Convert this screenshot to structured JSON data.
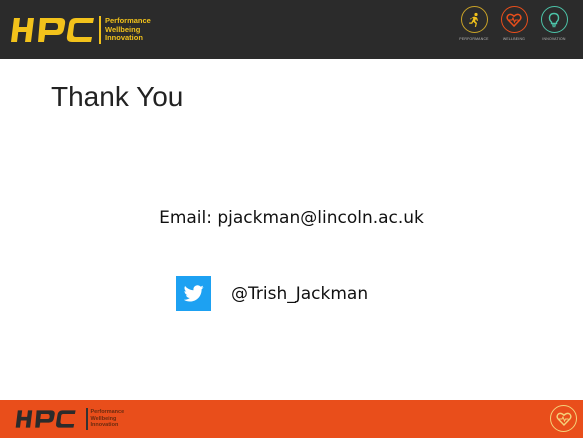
{
  "header": {
    "logo_text": "HPC",
    "logo_words": [
      "Performance",
      "Wellbeing",
      "Innovation"
    ],
    "icons": [
      {
        "name": "running-person-icon",
        "label": "PERFORMANCE"
      },
      {
        "name": "heart-icon",
        "label": "WELLBEING"
      },
      {
        "name": "lightbulb-icon",
        "label": "INNOVATION"
      }
    ]
  },
  "slide": {
    "title": "Thank You",
    "email": "Email: pjackman@lincoln.ac.uk",
    "twitter_handle": "@Trish_Jackman"
  },
  "footer": {
    "logo_text": "HPC",
    "logo_words": [
      "Performance",
      "Wellbeing",
      "Innovation"
    ],
    "icon": "heart-icon"
  },
  "colors": {
    "header_bg": "#2b2b2b",
    "brand_yellow": "#f2c21b",
    "footer_bg": "#e94e1b",
    "twitter_blue": "#1da1f2"
  }
}
